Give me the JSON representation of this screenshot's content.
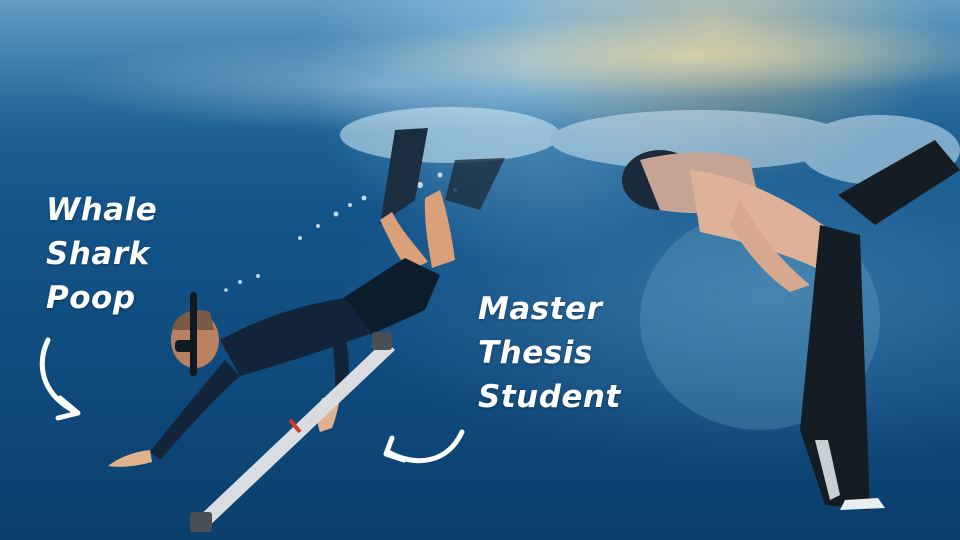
{
  "annotations": {
    "left_label": "Whale\nShark\nPoop",
    "right_label": "Master\nThesis\nStudent"
  },
  "colors": {
    "water_deep": "#0b3f6c",
    "water_mid": "#13548a",
    "water_surface": "#3f86b7",
    "label_text": "#ffffff"
  },
  "icons": {
    "left_arrow": "curved-arrow-down-icon",
    "right_arrow": "curved-arrow-left-icon"
  }
}
